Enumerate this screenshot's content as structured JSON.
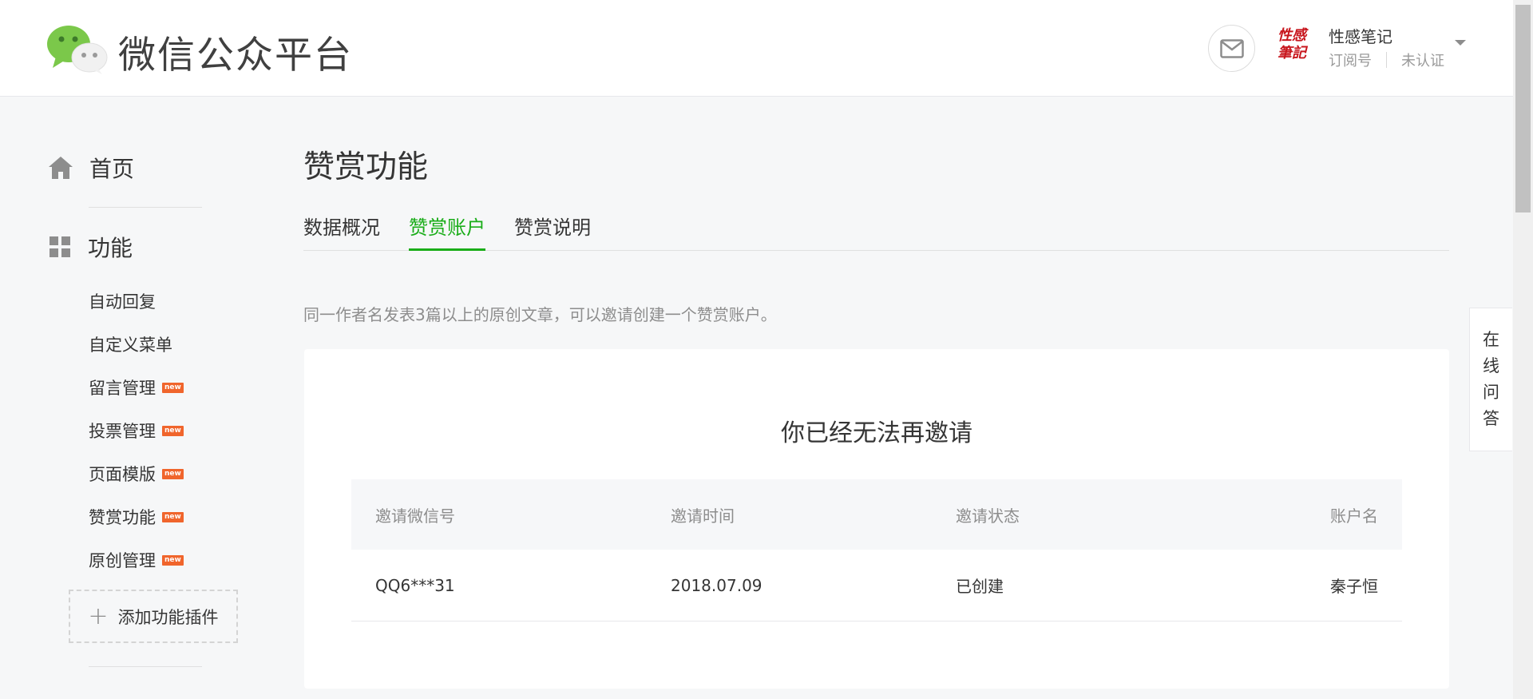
{
  "header": {
    "brand": "微信公众平台",
    "account": {
      "avatar_text": "性感筆記",
      "name": "性感笔记",
      "type": "订阅号",
      "verify_status": "未认证"
    }
  },
  "sidebar": {
    "home_label": "首页",
    "functions_label": "功能",
    "items": [
      {
        "label": "自动回复",
        "is_new": false
      },
      {
        "label": "自定义菜单",
        "is_new": false
      },
      {
        "label": "留言管理",
        "is_new": true
      },
      {
        "label": "投票管理",
        "is_new": true
      },
      {
        "label": "页面模版",
        "is_new": true
      },
      {
        "label": "赞赏功能",
        "is_new": true
      },
      {
        "label": "原创管理",
        "is_new": true
      }
    ],
    "new_badge": "new",
    "add_plugin_label": "添加功能插件"
  },
  "main": {
    "title": "赞赏功能",
    "tabs": [
      {
        "label": "数据概况",
        "active": false
      },
      {
        "label": "赞赏账户",
        "active": true
      },
      {
        "label": "赞赏说明",
        "active": false
      }
    ],
    "tip": "同一作者名发表3篇以上的原创文章，可以邀请创建一个赞赏账户。",
    "card_title": "你已经无法再邀请",
    "table": {
      "headers": [
        "邀请微信号",
        "邀请时间",
        "邀请状态",
        "账户名"
      ],
      "rows": [
        [
          "QQ6***31",
          "2018.07.09",
          "已创建",
          "秦子恒"
        ]
      ]
    }
  },
  "help_float": [
    "在",
    "线",
    "问",
    "答"
  ],
  "colors": {
    "accent": "#1aad19",
    "new_badge": "#f0652c",
    "avatar_red": "#c8171e"
  },
  "icons": [
    "wechat-logo-icon",
    "mail-icon",
    "home-icon",
    "grid-icon",
    "plus-icon",
    "caret-down-icon"
  ]
}
